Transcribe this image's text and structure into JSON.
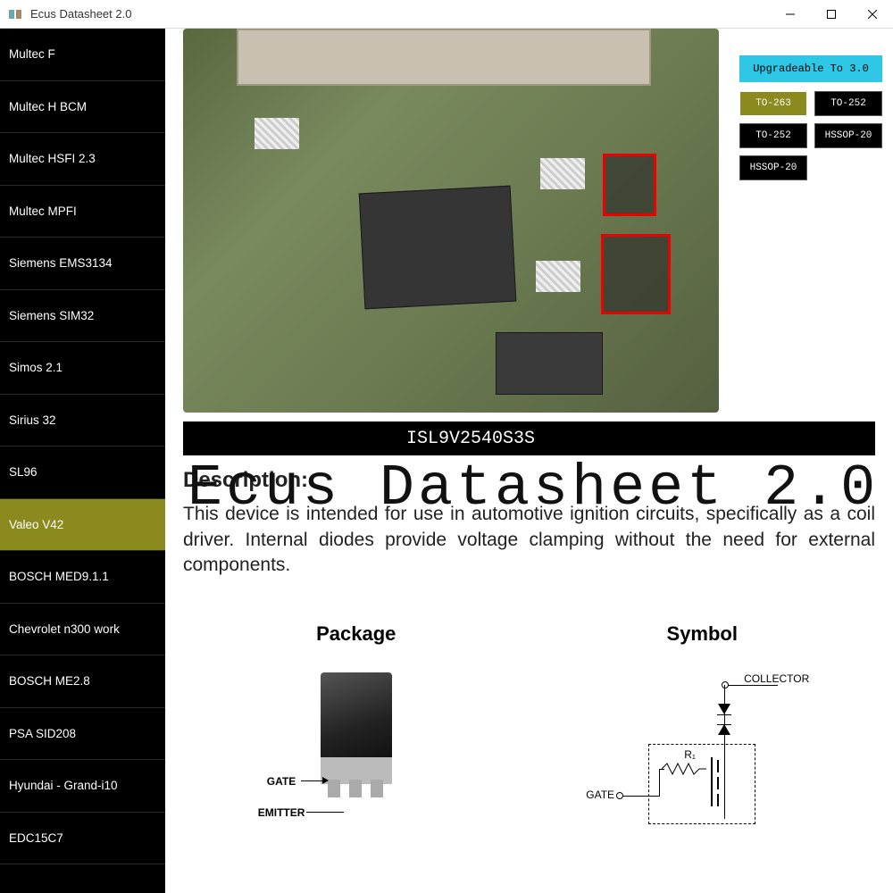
{
  "window": {
    "title": "Ecus Datasheet 2.0"
  },
  "sidebar": {
    "items": [
      {
        "label": "Multec F"
      },
      {
        "label": "Multec H BCM"
      },
      {
        "label": "Multec HSFI 2.3"
      },
      {
        "label": "Multec MPFI"
      },
      {
        "label": "Siemens EMS3134"
      },
      {
        "label": "Siemens SIM32"
      },
      {
        "label": "Simos 2.1"
      },
      {
        "label": "Sirius 32"
      },
      {
        "label": "SL96"
      },
      {
        "label": "Valeo V42",
        "selected": true
      },
      {
        "label": "BOSCH MED9.1.1"
      },
      {
        "label": "Chevrolet n300 work"
      },
      {
        "label": "BOSCH ME2.8"
      },
      {
        "label": "PSA SID208"
      },
      {
        "label": "Hyundai - Grand-i10"
      },
      {
        "label": "EDC15C7"
      }
    ]
  },
  "upgrade_banner": "Upgradeable To 3.0",
  "packages": [
    {
      "label": "TO-263",
      "active": true
    },
    {
      "label": "TO-252"
    },
    {
      "label": "TO-252"
    },
    {
      "label": "HSSOP-20"
    },
    {
      "label": "HSSOP-20"
    }
  ],
  "part_number": "ISL9V2540S3S",
  "description": {
    "heading": "Description:",
    "body": "This device is intended for use in automotive ignition circuits, specifically as a coil driver. Internal diodes provide voltage clamping without the need for external components."
  },
  "watermark": "Ecus Datasheet 2.0",
  "diagram": {
    "package_heading": "Package",
    "symbol_heading": "Symbol",
    "labels": {
      "gate": "GATE",
      "emitter": "EMITTER",
      "collector": "COLLECTOR",
      "r1": "R₁"
    }
  }
}
